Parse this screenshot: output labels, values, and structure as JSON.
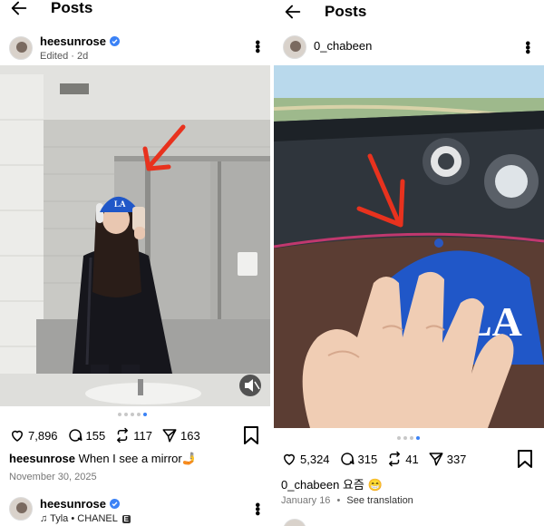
{
  "left": {
    "topbar": {
      "title": "Posts"
    },
    "header": {
      "username": "heesunrose",
      "subline": "Edited · 2d"
    },
    "actions": {
      "likes": "7,896",
      "comments": "155",
      "reposts": "117",
      "shares": "163"
    },
    "caption": {
      "username": "heesunrose",
      "text": " When I see a mirror🤳"
    },
    "date": "November 30, 2025",
    "next_post": {
      "username": "heesunrose",
      "music": "♫ Tyla • CHANEL",
      "explicit": "E"
    },
    "carousel": {
      "count": 5,
      "active_index": 4
    }
  },
  "right": {
    "topbar": {
      "title": "Posts"
    },
    "header": {
      "username": "0_chabeen"
    },
    "cap_logo": "LA",
    "actions": {
      "likes": "5,324",
      "comments": "315",
      "reposts": "41",
      "shares": "337"
    },
    "caption": {
      "username": "0_chabeen",
      "text": " 요즘 😁"
    },
    "date": "January 16",
    "separator": "•",
    "translation_link": "See translation",
    "carousel": {
      "count": 4,
      "active_index": 3
    }
  },
  "colors": {
    "accent": "#3b82f6",
    "arrow": "#e8321e",
    "cap": "#2057c8"
  }
}
